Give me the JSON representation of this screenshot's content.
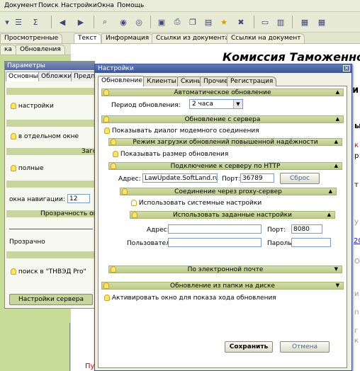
{
  "menubar": {
    "items": [
      "Документ",
      "Поиск",
      "Настройки",
      "Окна",
      "Помощь"
    ]
  },
  "top_tabs": [
    "Просмотренные",
    "Текст",
    "Информация",
    "Ссылки из документа",
    "Ссылки на документ"
  ],
  "left_tabs": [
    "ка",
    "Обновления"
  ],
  "page_title": "Комиссия Таможенного",
  "left_panel": {
    "title": "Параметры",
    "tabs": [
      "Основные",
      "Обложки",
      "Предп"
    ],
    "items": [
      "настройки",
      "в отдельном окне",
      "Заго",
      "полные",
      "окна навигации:",
      "12",
      "Прозрачность ок",
      "Прозрачно",
      "поиск в \"ТНВЭД Pro\"",
      "Настройки сервера"
    ]
  },
  "bg_fragments": [
    "и",
    "ы",
    "к",
    "р",
    "т",
    "у",
    "20",
    "О",
    "и",
    "п",
    "г",
    "к",
    "Пу"
  ],
  "dialog": {
    "title": "Настройки",
    "close_symbol": "✕",
    "tabs": [
      "Обновление",
      "Клиенты",
      "Скины",
      "Прочие",
      "Регистрация"
    ],
    "auto_update": {
      "header": "Автоматическое обновление",
      "period_label": "Период обновления:",
      "period_value": "2 часа"
    },
    "server_update": {
      "header": "Обновление с сервера",
      "show_modem": "Показывать диалог модемного соединения",
      "reliable_header": "Режим загрузки обновлений повышенной надёжности",
      "show_size": "Показывать размер обновления",
      "http_header": "Подключение к серверу по HTTP",
      "address_label": "Адрес:",
      "address_value": "LawUpdate.SoftLand.ru",
      "port_label": "Порт:",
      "port_value": "36789",
      "reset_label": "Сброс",
      "proxy_header": "Соединение через proxy-сервер",
      "use_system": "Использовать системные настройки",
      "custom_header": "Использовать заданные настройки",
      "proxy_address_label": "Адрес:",
      "proxy_address_value": "",
      "proxy_port_label": "Порт:",
      "proxy_port_value": "8080",
      "user_label": "Пользователь:",
      "user_value": "",
      "password_label": "Пароль:",
      "password_value": "",
      "email_header": "По электронной почте"
    },
    "disk_update": {
      "header": "Обновление из папки на диске"
    },
    "activate_window": "Активировать окно для показа хода обновления",
    "save_label": "Сохранить",
    "cancel_label": "Отмена"
  }
}
